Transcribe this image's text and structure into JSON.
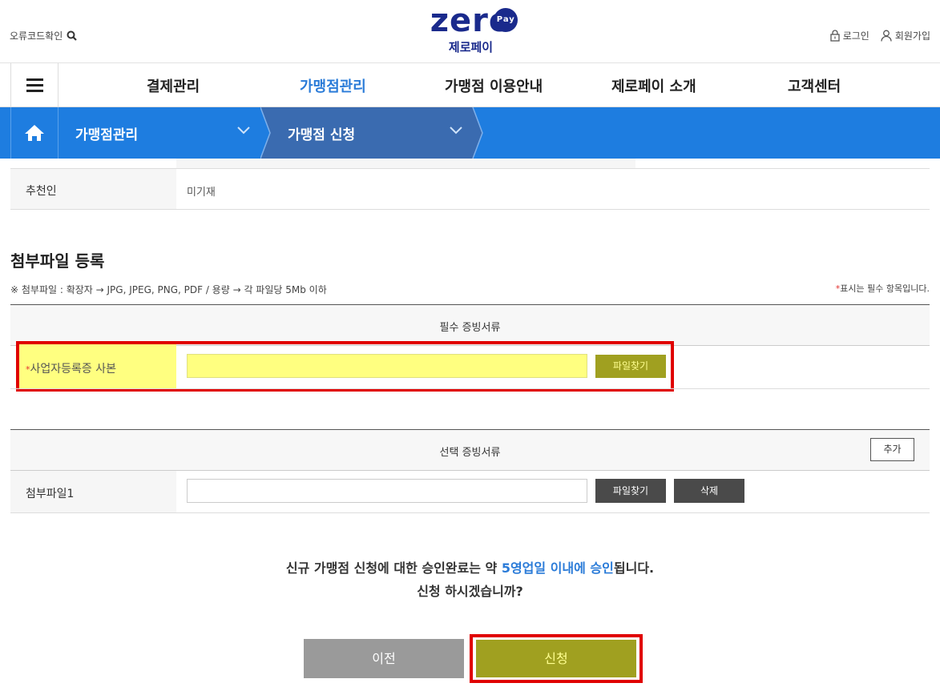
{
  "header": {
    "error_code_link": "오류코드확인",
    "logo_text": "zero",
    "logo_badge": "Pay",
    "logo_subtitle": "제로페이",
    "login": "로그인",
    "signup": "회원가입"
  },
  "nav": {
    "items": [
      {
        "label": "결제관리"
      },
      {
        "label": "가맹점관리",
        "active": true
      },
      {
        "label": "가맹점 이용안내"
      },
      {
        "label": "제로페이 소개"
      },
      {
        "label": "고객센터"
      }
    ]
  },
  "breadcrumb": {
    "level1": "가맹점관리",
    "level2": "가맹점 신청"
  },
  "recommender": {
    "label": "추천인",
    "value": "미기재"
  },
  "attachments": {
    "title": "첨부파일 등록",
    "note": "※ 첨부파일 : 확장자 → JPG, JPEG, PNG, PDF / 용량 → 각 파일당 5Mb 이하",
    "required_mark": "*",
    "required_note": "표시는 필수 항목입니다.",
    "required_section": {
      "title": "필수 증빙서류",
      "row_label": "사업자등록증 사본",
      "file_button": "파일찾기"
    },
    "optional_section": {
      "title": "선택 증빙서류",
      "add_button": "추가",
      "row_label": "첨부파일1",
      "file_button": "파일찾기",
      "delete_button": "삭제"
    }
  },
  "confirm": {
    "line1_prefix": "신규 가맹점 신청에 대한 승인완료는 약 ",
    "line1_highlight": "5영업일 이내에 승인",
    "line1_suffix": "됩니다.",
    "line2": "신청 하시겠습니까?"
  },
  "actions": {
    "prev": "이전",
    "submit": "신청"
  },
  "colors": {
    "brand_navy": "#1a2a8c",
    "nav_active": "#2a7bd8",
    "breadcrumb_blue": "#1e7de0",
    "highlight_yellow": "#ffff80",
    "highlight_olive": "#a0a020",
    "annotation_red": "#e00000"
  }
}
